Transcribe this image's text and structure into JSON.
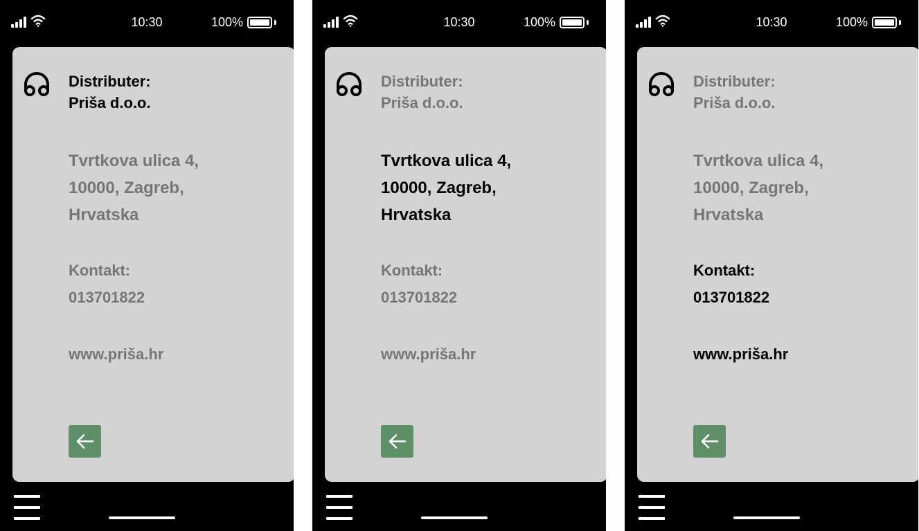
{
  "colors": {
    "background": "#000000",
    "card": "#d3d3d3",
    "text_highlight": "#000000",
    "text_dim": "#767676",
    "accent_button": "#5f8f69"
  },
  "screens": [
    {
      "status": {
        "time": "10:30",
        "battery": "100%",
        "signal_icon": "cellular-signal-icon",
        "wifi_icon": "wifi-icon",
        "battery_icon": "battery-icon"
      },
      "highlighted_block": "distributor",
      "distributor": {
        "label": "Distributer:",
        "name": "Priša d.o.o."
      },
      "address": {
        "street": "Tvrtkova ulica 4,",
        "city": "10000, Zagreb,",
        "country": "Hrvatska"
      },
      "contact": {
        "label": "Kontakt:",
        "phone": "013701822"
      },
      "website": "www.priša.hr",
      "back_icon": "arrow-left-icon",
      "menu_icon": "hamburger-menu-icon"
    },
    {
      "status": {
        "time": "10:30",
        "battery": "100%",
        "signal_icon": "cellular-signal-icon",
        "wifi_icon": "wifi-icon",
        "battery_icon": "battery-icon"
      },
      "highlighted_block": "address",
      "distributor": {
        "label": "Distributer:",
        "name": "Priša d.o.o."
      },
      "address": {
        "street": "Tvrtkova ulica 4,",
        "city": "10000, Zagreb,",
        "country": "Hrvatska"
      },
      "contact": {
        "label": "Kontakt:",
        "phone": "013701822"
      },
      "website": "www.priša.hr",
      "back_icon": "arrow-left-icon",
      "menu_icon": "hamburger-menu-icon"
    },
    {
      "status": {
        "time": "10:30",
        "battery": "100%",
        "signal_icon": "cellular-signal-icon",
        "wifi_icon": "wifi-icon",
        "battery_icon": "battery-icon"
      },
      "highlighted_block": "contact",
      "distributor": {
        "label": "Distributer:",
        "name": "Priša d.o.o."
      },
      "address": {
        "street": "Tvrtkova ulica 4,",
        "city": "10000, Zagreb,",
        "country": "Hrvatska"
      },
      "contact": {
        "label": "Kontakt:",
        "phone": "013701822"
      },
      "website": "www.priša.hr",
      "back_icon": "arrow-left-icon",
      "menu_icon": "hamburger-menu-icon"
    }
  ]
}
